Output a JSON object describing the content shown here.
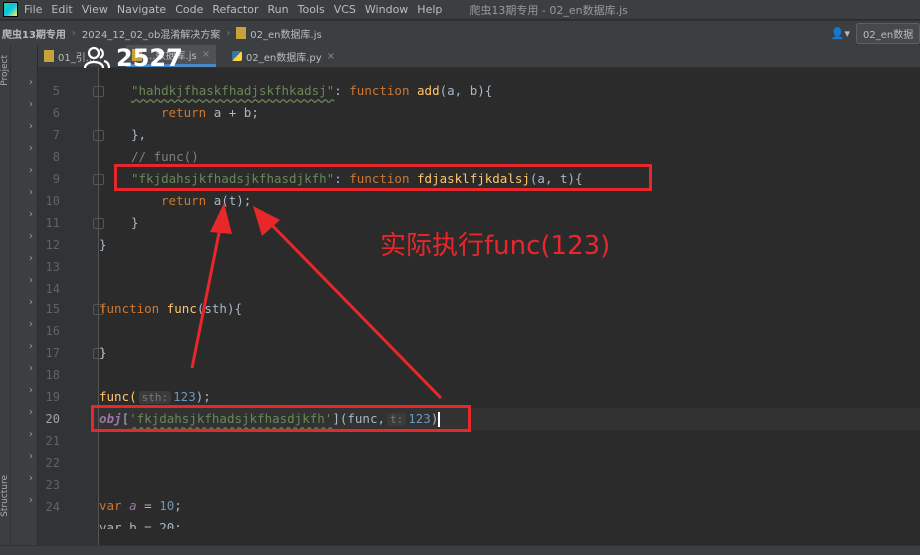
{
  "menubar": {
    "items": [
      "File",
      "Edit",
      "View",
      "Navigate",
      "Code",
      "Refactor",
      "Run",
      "Tools",
      "VCS",
      "Window",
      "Help"
    ],
    "title": "爬虫13期专用 - 02_en数据库.js"
  },
  "navbar": {
    "crumbs": [
      "爬虫13期专用",
      "2024_12_02_ob混淆解决方案",
      "02_en数据库.js"
    ],
    "run_config": "02_en数据"
  },
  "tabs": [
    {
      "label": "01_引..."
    },
    {
      "label": "...数据库.js"
    },
    {
      "label": "02_en数据库.py"
    }
  ],
  "viewer_count": "2527",
  "annotation": "实际执行func(123)",
  "gutter": {
    "line_numbers": [
      "5",
      "6",
      "7",
      "8",
      "9",
      "10",
      "11",
      "12",
      "13",
      "14",
      "15",
      "16",
      "17",
      "18",
      "19",
      "20",
      "21",
      "22",
      "23",
      "24"
    ],
    "current_line": "20"
  },
  "code": {
    "l5_key": "\"hahdkjfhaskfhadjskfhkadsj\"",
    "l5_rest_kw": "function",
    "l5_name": "add",
    "l5_params": "(a, b){",
    "l6": "a + b;",
    "l6_kw": "return",
    "l7": "},",
    "l8": "// func()",
    "l9_key": "\"fkjdahsjkfhadsjkfhasdjkfh\"",
    "l9_kw": "function",
    "l9_name": "fdjasklfjkdalsj",
    "l9_params": "(a, t){",
    "l10_kw": "return",
    "l10_rest": "a(t);",
    "l11": "}",
    "l12": "}",
    "l15_kw": "function",
    "l15_name": "func",
    "l15_params": "(sth){",
    "l17": "}",
    "l19_name": "func(",
    "l19_hint": "sth:",
    "l19_num": "123",
    "l19_end": ");",
    "l20_obj": "obj",
    "l20_open": "[",
    "l20_key": "'fkjdahsjkfhadsjkfhasdjkfh'",
    "l20_mid": "](func,",
    "l20_hint": "t:",
    "l20_num": "123",
    "l20_end": ")",
    "l24_kw": "var",
    "l24_var": "a",
    "l24_eq": " = ",
    "l24_num": "10",
    "l24_end": ";",
    "l25_partial": "var b = 20;"
  },
  "colors": {
    "annotation_red": "#e8272a",
    "editor_bg": "#2b2b2b"
  }
}
